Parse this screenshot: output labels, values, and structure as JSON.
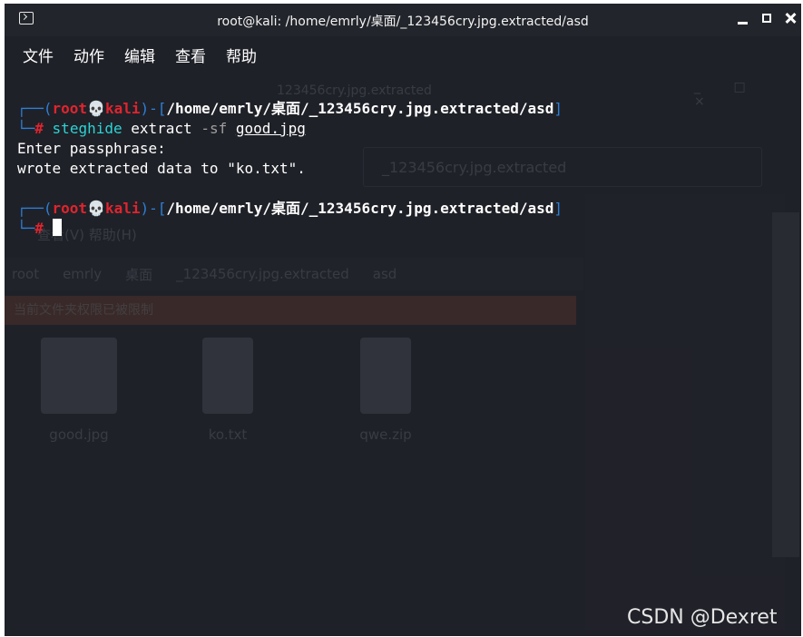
{
  "window": {
    "title": "root@kali: /home/emrly/桌面/_123456cry.jpg.extracted/asd"
  },
  "menu": {
    "items": [
      "文件",
      "动作",
      "编辑",
      "查看",
      "帮助"
    ]
  },
  "terminal": {
    "prompt1": {
      "open": "┌──(",
      "user": "root",
      "skull": "💀",
      "host": "kali",
      "sep": ")-[",
      "path": "/home/emrly/桌面/_123456cry.jpg.extracted/asd",
      "close": "]",
      "corner": "└─",
      "hash": "#"
    },
    "command": {
      "program": "steghide",
      "subcommand": "extract",
      "flag": "-sf",
      "file": "good.jpg"
    },
    "output": [
      "Enter passphrase:",
      "wrote extracted data to \"ko.txt\"."
    ],
    "prompt2": {
      "open": "┌──(",
      "user": "root",
      "skull": "💀",
      "host": "kali",
      "sep": ")-[",
      "path": "/home/emrly/桌面/_123456cry.jpg.extracted/asd",
      "close": "]",
      "corner": "└─",
      "hash": "#"
    }
  },
  "background_window": {
    "title": "123456cry.jpg.extracted",
    "path_box": "_123456cry.jpg.extracted",
    "menu": "查看(V)  帮助(H)",
    "breadcrumbs": [
      "root",
      "emrly",
      "桌面",
      "_123456cry.jpg.extracted",
      "asd"
    ],
    "warning": "当前文件夹权限已被限制",
    "files": [
      {
        "name": "good.jpg",
        "icon": "image-file-icon"
      },
      {
        "name": "ko.txt",
        "icon": "text-file-icon"
      },
      {
        "name": "qwe.zip",
        "icon": "zip-file-icon"
      }
    ]
  },
  "watermark": "CSDN @Dexret",
  "colors": {
    "background": "#1f2128",
    "prompt_frame": "#2e7fd6",
    "user_host": "#e0242e",
    "command": "#2bd4d6"
  }
}
